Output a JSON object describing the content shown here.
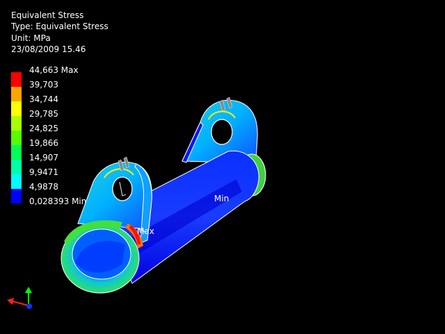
{
  "header": {
    "title": "Equivalent Stress",
    "type_line": "Type: Equivalent Stress",
    "unit_line": "Unit: MPa",
    "date_line": "23/08/2009 15.46"
  },
  "legend": {
    "items": [
      {
        "label": "44,663 Max",
        "color": "#ff0000"
      },
      {
        "label": "39,703",
        "color": "#ffa500"
      },
      {
        "label": "34,744",
        "color": "#ffff00"
      },
      {
        "label": "29,785",
        "color": "#aaff00"
      },
      {
        "label": "24,825",
        "color": "#55ff00"
      },
      {
        "label": "19,866",
        "color": "#00ff55"
      },
      {
        "label": "14,907",
        "color": "#00ffaa"
      },
      {
        "label": "9,9471",
        "color": "#00ffff"
      },
      {
        "label": "4,9878",
        "color": "#0080ff"
      },
      {
        "label": "0,028393 Min",
        "color": "#0000ff"
      }
    ]
  },
  "model": {
    "max_label": "Max",
    "min_label": "Min"
  }
}
